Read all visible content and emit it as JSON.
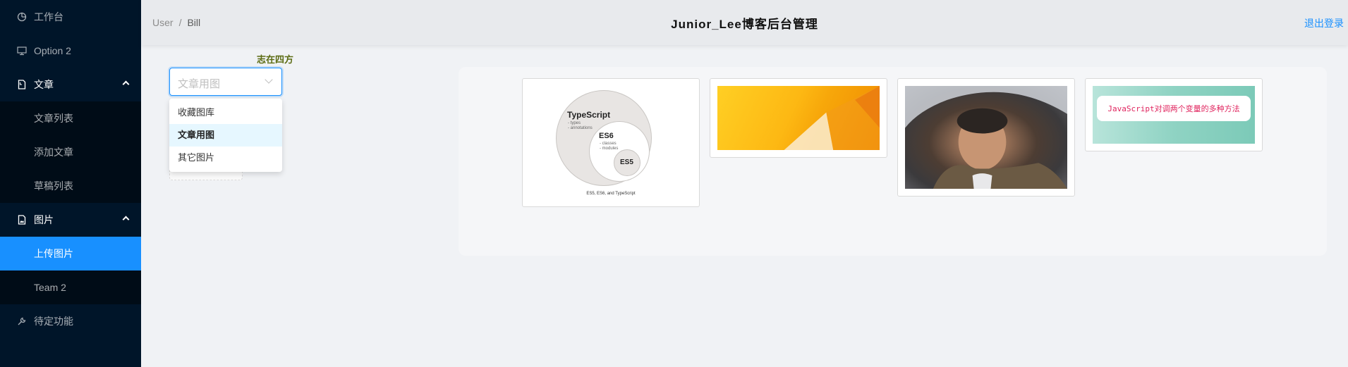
{
  "sidebar": {
    "items": [
      {
        "label": "工作台",
        "icon": "pie-chart-icon"
      },
      {
        "label": "Option 2",
        "icon": "desktop-icon"
      },
      {
        "label": "文章",
        "icon": "file-icon"
      },
      {
        "label": "文章列表"
      },
      {
        "label": "添加文章"
      },
      {
        "label": "草稿列表"
      },
      {
        "label": "图片",
        "icon": "file-image-icon"
      },
      {
        "label": "上传图片"
      },
      {
        "label": "Team 2"
      },
      {
        "label": "待定功能",
        "icon": "tool-icon"
      }
    ]
  },
  "header": {
    "breadcrumb": [
      "User",
      "Bill"
    ],
    "separator": "/",
    "title": "Junior_Lee博客后台管理",
    "logout": "退出登录"
  },
  "content": {
    "motto": "志在四方",
    "select": {
      "value": "文章用图",
      "options": [
        "收藏图库",
        "文章用图",
        "其它图片"
      ]
    },
    "gallery": [
      {
        "name": "typescript-diagram",
        "texts": {
          "ts": "TypeScript",
          "ts_sub": "- types\n- annotations",
          "es6": "ES6",
          "es6_sub": "- classes\n- modules",
          "es5": "ES5",
          "caption": "ES5, ES6, and TypeScript"
        }
      },
      {
        "name": "orange-wallpaper"
      },
      {
        "name": "person-umbrella-photo"
      },
      {
        "name": "js-article-cover",
        "text": "JavaScript对调两个变量的多种方法"
      }
    ]
  },
  "colors": {
    "sidebar_bg": "#001529",
    "submenu_bg": "#000c17",
    "accent": "#1890ff",
    "motto": "#5b6b12"
  }
}
